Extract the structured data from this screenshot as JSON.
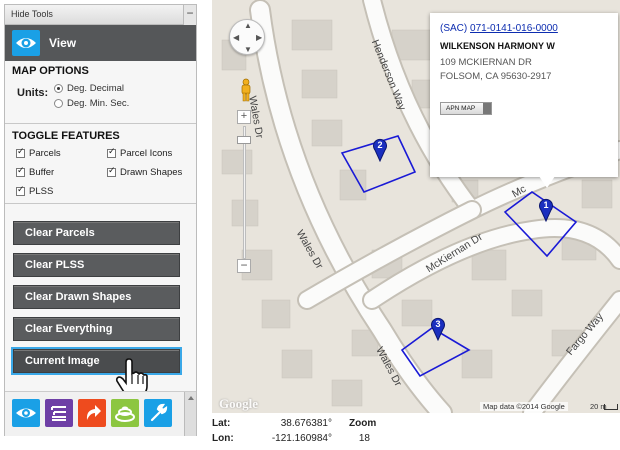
{
  "sidebar": {
    "hide_tools": "Hide Tools",
    "collapse": "−",
    "view_title": "View",
    "map_options_title": "MAP OPTIONS",
    "units_label": "Units:",
    "unit_options": [
      "Deg. Decimal",
      "Deg. Min. Sec."
    ],
    "unit_selected": "Deg. Decimal",
    "toggle_features_title": "TOGGLE FEATURES",
    "features": [
      {
        "label": "Parcels",
        "checked": true
      },
      {
        "label": "Parcel Icons",
        "checked": true
      },
      {
        "label": "Buffer",
        "checked": true
      },
      {
        "label": "Drawn Shapes",
        "checked": true
      },
      {
        "label": "PLSS",
        "checked": true
      }
    ],
    "actions": [
      "Clear Parcels",
      "Clear PLSS",
      "Clear Drawn Shapes",
      "Clear Everything",
      "Current Image"
    ],
    "active_action": "Current Image",
    "bottom_tools": [
      "eye-icon",
      "layers-icon",
      "arrow-icon",
      "stack-icon",
      "wrench-icon"
    ],
    "tool_colors": [
      "#1aa0e6",
      "#6e3fa6",
      "#ee4b1e",
      "#8cc640",
      "#1aa0e6"
    ]
  },
  "map": {
    "streets": [
      "Henderson Way",
      "Wales Dr",
      "Wales Dr",
      "McKiernan Dr",
      "Wales Dr",
      "Fargo Way",
      "Mc"
    ],
    "markers": [
      "1",
      "2",
      "3"
    ],
    "google": "Google",
    "credit": "Map data ©2014 Google",
    "scale": "20 m",
    "parcel_color": "#1a1ad6"
  },
  "info": {
    "prefix": "(SAC)",
    "apn": "071-0141-016-0000",
    "owner": "WILKENSON HARMONY W",
    "address1": "109 MCKIERNAN DR",
    "address2": "FOLSOM, CA 95630-2917",
    "apn_map_button": "APN MAP"
  },
  "coords": {
    "lat_label": "Lat:",
    "lat_value": "38.676381°",
    "lon_label": "Lon:",
    "lon_value": "-121.160984°",
    "zoom_label": "Zoom",
    "zoom_value": "18"
  }
}
